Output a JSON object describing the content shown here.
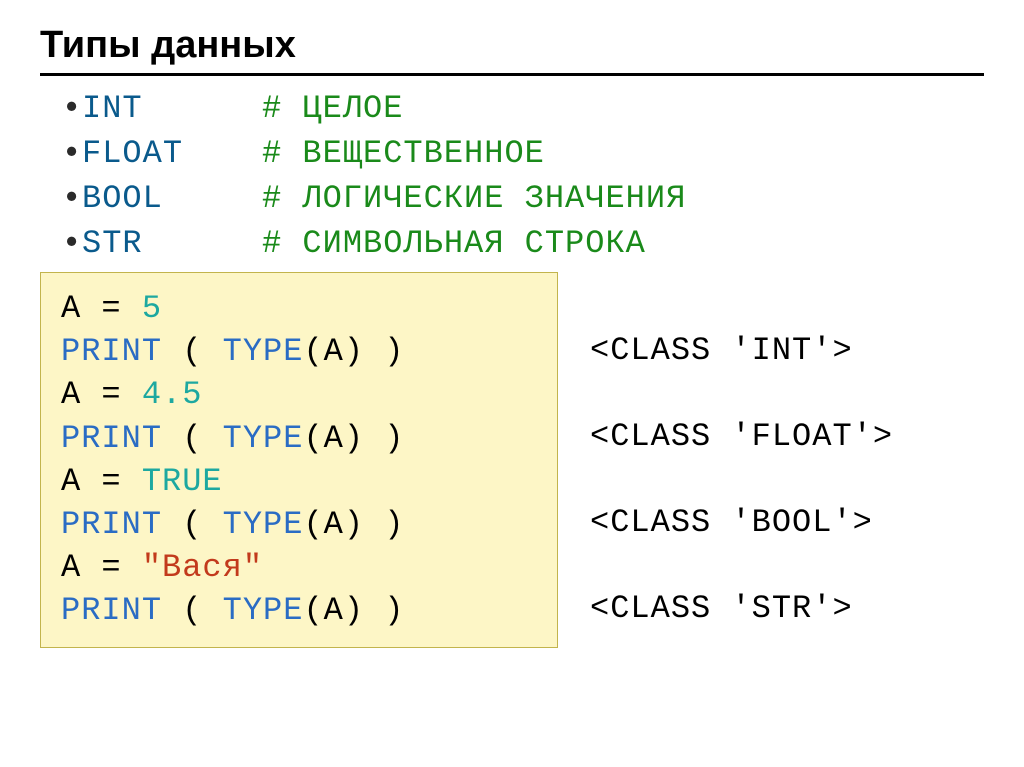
{
  "title": "Типы данных",
  "types": [
    {
      "name": "INT",
      "desc": "# ЦЕЛОЕ"
    },
    {
      "name": "FLOAT",
      "desc": "# ВЕЩЕСТВЕННОЕ"
    },
    {
      "name": "BOOL",
      "desc": "# ЛОГИЧЕСКИЕ ЗНАЧЕНИЯ"
    },
    {
      "name": "STR",
      "desc": "# СИМВОЛЬНАЯ СТРОКА"
    }
  ],
  "code": {
    "assign1_lhs": "A = ",
    "assign1_val": "5",
    "print_open": "PRINT",
    "paren_open": " ( ",
    "type_call": "TYPE",
    "type_arg": "(A)",
    "paren_close": " )",
    "assign2_lhs": "A = ",
    "assign2_val": "4.5",
    "assign3_lhs": "A = ",
    "assign3_val": "TRUE",
    "assign4_lhs": "A = ",
    "assign4_val": "\"Вася\""
  },
  "outputs": {
    "o1": "<CLASS 'INT'>",
    "o2": "<CLASS 'FLOAT'>",
    "o3": "<CLASS 'BOOL'>",
    "o4": "<CLASS 'STR'>"
  }
}
